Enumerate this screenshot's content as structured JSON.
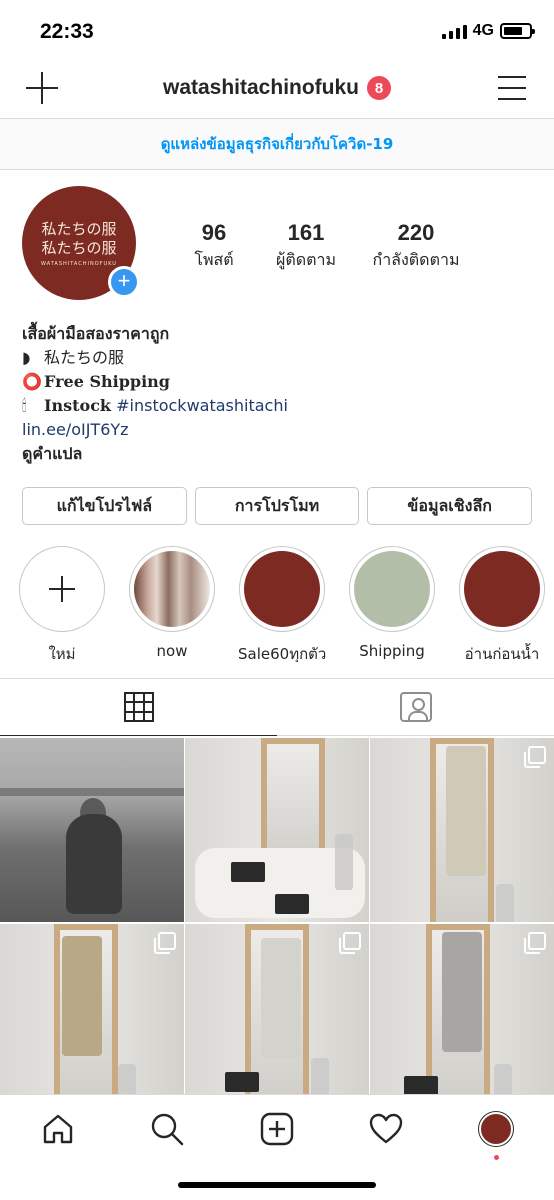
{
  "status_bar": {
    "time": "22:33",
    "network": "4G"
  },
  "header": {
    "username": "watashitachinofuku",
    "notification_count": "8",
    "icons": [
      "plus-icon",
      "menu-icon"
    ]
  },
  "covid_banner": {
    "text": "ดูแหล่งข้อมูลธุรกิจเกี่ยวกับโควิด-19"
  },
  "profile": {
    "avatar": {
      "line1": "私たちの服",
      "line2": "私たちの服",
      "sub": "WATASHITACHINOFUKU",
      "color": "#7d2a23"
    },
    "stats": [
      {
        "value": "96",
        "label": "โพสต์"
      },
      {
        "value": "161",
        "label": "ผู้ติดตาม"
      },
      {
        "value": "220",
        "label": "กำลังติดตาม"
      }
    ],
    "bio": {
      "name": "เสื้อผ้ามือสองราคาถูก",
      "line2_mark": "◗",
      "line2": "私たちの服",
      "line3_mark": "⭕",
      "line3": "Free Shipping",
      "line4_mark": "🕯",
      "line4": "Instock",
      "hashtag": "#instockwatashitachi",
      "link": "lin.ee/oIJT6Yz",
      "see_translation": "ดูคำแปล"
    }
  },
  "actions": {
    "edit_profile": "แก้ไขโปรไฟล์",
    "promotions": "การโปรโมท",
    "insights": "ข้อมูลเชิงลึก"
  },
  "highlights": [
    {
      "label": "ใหม่",
      "kind": "new"
    },
    {
      "label": "now",
      "kind": "photo"
    },
    {
      "label": "Sale60ทุกตัว",
      "kind": "color",
      "color": "#7d2a23"
    },
    {
      "label": "Shipping",
      "kind": "color",
      "color": "#b3bea8"
    },
    {
      "label": "อ่านก่อนน้ำ",
      "kind": "color",
      "color": "#7d2a23"
    }
  ],
  "tabs": {
    "active": "grid",
    "icons": [
      "grid-icon",
      "tagged-icon"
    ]
  },
  "colors": {
    "accent": "#0095f6",
    "badge": "#ed4956",
    "link": "#1f3a6b",
    "brand": "#7d2a23"
  },
  "bottom_nav": {
    "icons": [
      "home-icon",
      "search-icon",
      "add-post-icon",
      "heart-icon",
      "profile-icon"
    ]
  }
}
